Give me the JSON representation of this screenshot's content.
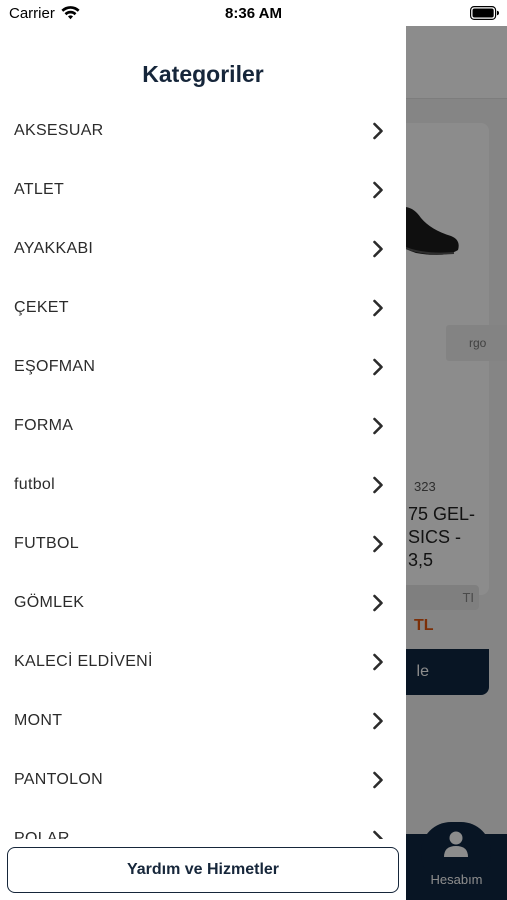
{
  "status_bar": {
    "carrier": "Carrier",
    "time": "8:36 AM"
  },
  "drawer": {
    "title": "Kategoriler",
    "categories": [
      "AKSESUAR",
      "ATLET",
      "AYAKKABI",
      "ÇEKET",
      "EŞOFMAN",
      "FORMA",
      "futbol",
      "FUTBOL",
      "GÖMLEK",
      "KALECİ ELDİVENİ",
      "MONT",
      "PANTOLON",
      "POLAR"
    ],
    "help_button_label": "Yardım ve Hizmetler"
  },
  "background": {
    "badge_text": "rgo",
    "product_code": "323",
    "product_name": "75 GEL-\nSICS -\n3,5",
    "tag_text": "TI",
    "price": "TL",
    "buy_button_label": "le",
    "account_label": "Hesabım"
  },
  "colors": {
    "navy": "#16263a",
    "tabbar": "#0f2742",
    "price": "#e2570f"
  }
}
